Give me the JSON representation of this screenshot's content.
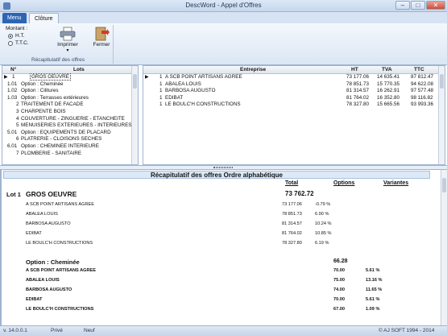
{
  "window": {
    "title": "DescWord - Appel d'Offres"
  },
  "tabs": [
    {
      "label": "Menu"
    },
    {
      "label": "Clôture"
    }
  ],
  "ribbon": {
    "montant_label": "Montant :",
    "options": [
      {
        "label": "H.T.",
        "checked": true
      },
      {
        "label": "T.T.C.",
        "checked": false
      }
    ],
    "imprimer_label": "Imprimer",
    "fermer_label": "Fermer",
    "group_caption": "Récapitulatif des offres"
  },
  "lots_grid": {
    "headers": {
      "num": "N°",
      "lots": "Lots"
    },
    "rows": [
      {
        "num": "1",
        "label": "GROS OEUVRE"
      },
      {
        "num": "1.01",
        "label": "Option : Cheminée"
      },
      {
        "num": "1.02",
        "label": "Option : Cilitures"
      },
      {
        "num": "1.03",
        "label": "Option : Terrasses extérieures"
      },
      {
        "num": "2",
        "label": "TRAITEMENT DE FACADE"
      },
      {
        "num": "3",
        "label": "CHARPENTE BOIS"
      },
      {
        "num": "4",
        "label": "COUVERTURE - ZINGUERIE - ETANCHEITE"
      },
      {
        "num": "5",
        "label": "MENUISERIES EXTERIEURES - INTERIEURES"
      },
      {
        "num": "5.01",
        "label": "Option : EQUIPEMENTS DE PLACARD"
      },
      {
        "num": "6",
        "label": "PLATRERIE - CLOISONS SECHES"
      },
      {
        "num": "6.01",
        "label": "Option : CHEMINEE INTERIEURE"
      },
      {
        "num": "7",
        "label": "PLOMBERIE - SANITAIRE"
      }
    ]
  },
  "entreprise_grid": {
    "headers": {
      "entreprise": "Entreprise",
      "ht": "HT",
      "tva": "TVA",
      "ttc": "TTC"
    },
    "rows": [
      {
        "n": "1",
        "name": "A SCB POINT ARTISANS AGREE",
        "ht": "73 177.06",
        "tva": "14 635.41",
        "ttc": "87 812.47"
      },
      {
        "n": "1",
        "name": "ABALEA LOUIS",
        "ht": "78 851.73",
        "tva": "15 770.35",
        "ttc": "94 622.08"
      },
      {
        "n": "1",
        "name": "BARBOSA AUGUSTO",
        "ht": "81 314.57",
        "tva": "16 262.91",
        "ttc": "97 577.48"
      },
      {
        "n": "1",
        "name": "EDIBAT",
        "ht": "81 764.02",
        "tva": "16 352.80",
        "ttc": "98 116.82"
      },
      {
        "n": "1",
        "name": "LE BOULC'H CONSTRUCTIONS",
        "ht": "78 327.80",
        "tva": "15 665.56",
        "ttc": "93 993.36"
      }
    ]
  },
  "report": {
    "title": "Récapitulatif des offres Ordre alphabétique",
    "col_total": "Total",
    "col_options": "Options",
    "col_variantes": "Variantes",
    "lot1": {
      "prefix": "Lot 1",
      "name": "GROS OEUVRE",
      "total": "73 762.72",
      "rows": [
        {
          "name": "A SCB POINT ARTISANS AGREE",
          "total": "73 177.06",
          "pct": "-0.79 %"
        },
        {
          "name": "ABALEA LOUIS",
          "total": "78 851.73",
          "pct": "6.90 %"
        },
        {
          "name": "BARBOSA AUGUSTO",
          "total": "81 314.57",
          "pct": "10.24 %"
        },
        {
          "name": "EDIBAT",
          "total": "81 764.02",
          "pct": "10.85 %"
        },
        {
          "name": "LE BOULC'H CONSTRUCTIONS",
          "total": "78 327.80",
          "pct": "6.19 %"
        }
      ]
    },
    "option": {
      "name": "Option : Cheminée",
      "total": "66.28",
      "rows": [
        {
          "name": "A SCB POINT ARTISANS AGREE",
          "value": "70.00",
          "pct": "5.61 %"
        },
        {
          "name": "ABALEA LOUIS",
          "value": "75.00",
          "pct": "13.16 %"
        },
        {
          "name": "BARBOSA AUGUSTO",
          "value": "74.00",
          "pct": "11.65 %"
        },
        {
          "name": "EDIBAT",
          "value": "70.00",
          "pct": "5.61 %"
        },
        {
          "name": "LE BOULC'H CONSTRUCTIONS",
          "value": "67.00",
          "pct": "1.09 %"
        }
      ]
    }
  },
  "status": {
    "version": "v. 14.0.0.1",
    "mode": "Privé",
    "state": "Neuf",
    "copyright": "© AJ SOFT 1994 - 2014"
  }
}
